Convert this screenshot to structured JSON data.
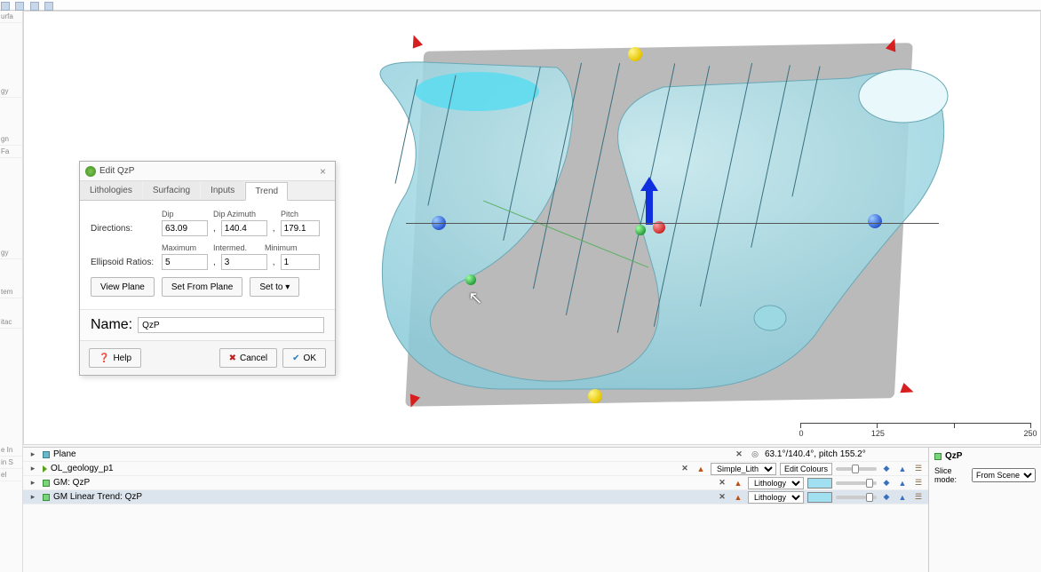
{
  "sidebar": {
    "stubs": [
      "urfa",
      "gy",
      "gn",
      "Fa",
      "gy",
      "tem",
      "itac",
      "e In",
      "in S",
      "el"
    ]
  },
  "dialog": {
    "title": "Edit QzP",
    "tabs": [
      "Lithologies",
      "Surfacing",
      "Inputs",
      "Trend"
    ],
    "active_tab": 3,
    "directions_label": "Directions:",
    "dip_label": "Dip",
    "dip_azimuth_label": "Dip Azimuth",
    "pitch_label": "Pitch",
    "dip": "63.09",
    "dip_azimuth": "140.4",
    "pitch": "179.1",
    "ratios_label": "Ellipsoid Ratios:",
    "max_label": "Maximum",
    "intermed_label": "Intermed.",
    "min_label": "Minimum",
    "ratio_max": "5",
    "ratio_int": "3",
    "ratio_min": "1",
    "view_plane": "View Plane",
    "set_from_plane": "Set From Plane",
    "set_to": "Set to",
    "name_label": "Name:",
    "name_value": "QzP",
    "help": "Help",
    "cancel": "Cancel",
    "ok": "OK"
  },
  "ruler": {
    "ticks": [
      "0",
      "125",
      "250"
    ]
  },
  "objects": {
    "rows": [
      {
        "name": "Plane",
        "info": "63.1°/140.4°, pitch 155.2°"
      },
      {
        "name": "OL_geology_p1",
        "legend": "Simple_Lith",
        "edit": "Edit Colours"
      },
      {
        "name": "GM: QzP",
        "legend": "Lithology"
      },
      {
        "name": "GM Linear Trend: QzP",
        "legend": "Lithology"
      }
    ]
  },
  "properties": {
    "title": "QzP",
    "slice_label": "Slice mode:",
    "slice_value": "From Scene"
  }
}
